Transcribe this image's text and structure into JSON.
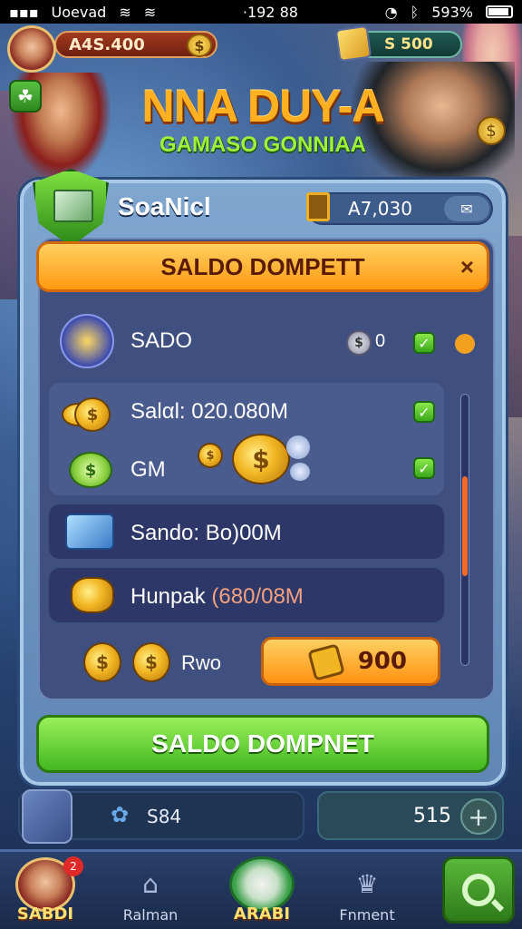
{
  "status_bar": {
    "carrier": "Uoevad",
    "time": "·192 88",
    "battery": "593%"
  },
  "hud": {
    "coins": "A4S.400",
    "coin_symbol": "$",
    "gems": "S 500"
  },
  "game": {
    "title": "NNA DUY-A",
    "subtitle": "GAMASO GONNIAA"
  },
  "panel": {
    "title": "SoaNicl",
    "balance": "A7,030",
    "header": "SALDO DOMPETT",
    "close": "×",
    "rows": [
      {
        "label": "SADO",
        "value": "0"
      },
      {
        "label": "Salαl: 020.080M"
      },
      {
        "label": "GM"
      },
      {
        "label": "Sando: Bo)00M"
      },
      {
        "label": "Hunpak",
        "value": "(680/08M"
      },
      {
        "label": "Rwo"
      }
    ],
    "buy_amount": "900",
    "confirm_button": "SALDO DOMPNET"
  },
  "bottom": {
    "item_label": "S84",
    "count": "515",
    "plus": "+"
  },
  "nav": {
    "items": [
      {
        "label": "SABDI",
        "badge": "2"
      },
      {
        "label": "Ralman"
      },
      {
        "label": "ARABI"
      },
      {
        "label": "Fnment"
      }
    ]
  },
  "colors": {
    "orange": "#ff9a10",
    "green": "#42b820",
    "panel": "#3e4f80"
  }
}
